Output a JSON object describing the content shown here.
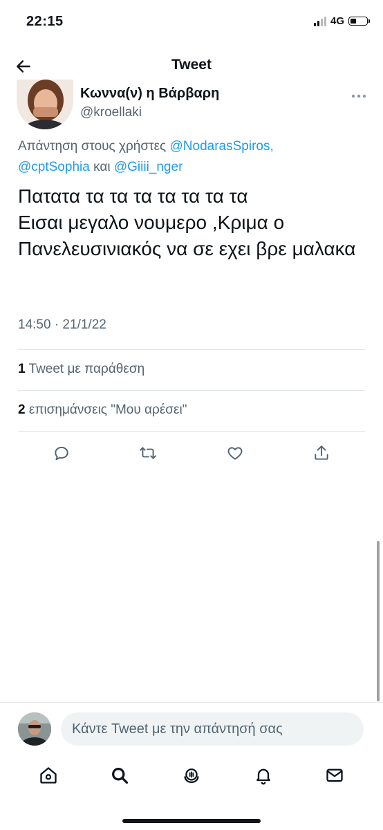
{
  "status_bar": {
    "time": "22:15",
    "network": "4G"
  },
  "header": {
    "title": "Tweet"
  },
  "tweet": {
    "author_name": "Κωννα(ν) η Βάρβαρη",
    "author_handle": "@kroellaki",
    "reply_prefix": "Απάντηση στους χρήστες",
    "mention_1": "@NodarasSpiros,",
    "mention_2": "@cptSophia",
    "reply_and": "και",
    "mention_3": "@Giiii_nger",
    "text": "Πατατα τα τα τα τα τα τα τα\nΕισαι μεγαλο νουμερο ,Κριμα ο Πανελευσινιακός να σε εχει βρε μαλακα",
    "timestamp": "14:50 · 21/1/22",
    "quote_count": "1",
    "quote_label": "Tweet με παράθεση",
    "like_count": "2",
    "like_label": "επισημάνσεις \"Μου αρέσει\""
  },
  "composer": {
    "placeholder": "Κάντε Tweet με την απάντησή σας"
  },
  "icons": {
    "back": "arrow-left-icon",
    "more": "more-icon",
    "reply": "reply-icon",
    "retweet": "retweet-icon",
    "like": "heart-icon",
    "share": "share-icon",
    "home": "home-icon",
    "search": "search-icon",
    "spaces": "spaces-icon",
    "notifications": "bell-icon",
    "messages": "mail-icon"
  },
  "colors": {
    "link": "#1d9bf0",
    "secondary_text": "#536471",
    "primary_text": "#0f1419"
  }
}
